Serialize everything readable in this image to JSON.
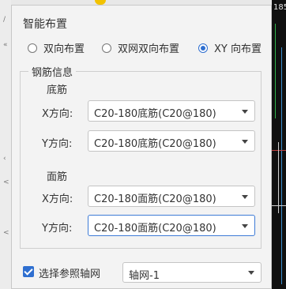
{
  "background": {
    "left_ticks": [
      "/",
      "«",
      "‹",
      "<",
      "<"
    ],
    "cad_number": "185"
  },
  "dialog": {
    "title": "智能布置",
    "layout_options": [
      {
        "label": "双向布置",
        "checked": false
      },
      {
        "label": "双网双向布置",
        "checked": false
      },
      {
        "label": "XY 向布置",
        "checked": true
      }
    ],
    "rebar_info": {
      "legend": "钢筋信息",
      "bottom": {
        "label": "底筋",
        "x_label": "X方向:",
        "x_value": "C20-180底筋(C20@180)",
        "y_label": "Y方向:",
        "y_value": "C20-180底筋(C20@180)"
      },
      "top": {
        "label": "面筋",
        "x_label": "X方向:",
        "x_value": "C20-180面筋(C20@180)",
        "y_label": "Y方向:",
        "y_value": "C20-180面筋(C20@180)"
      }
    },
    "axis_grid": {
      "checkbox_label": "选择参照轴网",
      "checked": true,
      "selected": "轴网-1"
    }
  },
  "colors": {
    "accent": "#2f6fd0",
    "dialog_bg": "#f3f3f3",
    "cad_bg": "#101010"
  }
}
